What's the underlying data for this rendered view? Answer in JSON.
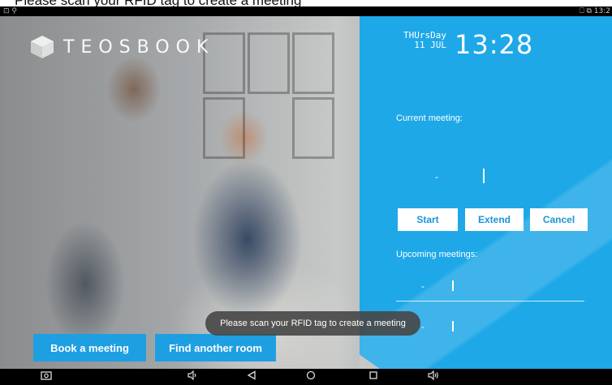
{
  "banner": {
    "text": "Please scan your RFID tag to create a meeting"
  },
  "statusbar": {
    "left_icons": "⊡ ⚲",
    "right_text": "⎕ ⧉  13:2"
  },
  "brand": {
    "name": "TEOSBOOK"
  },
  "clock": {
    "weekday": "THUrsDay",
    "date": "11 JUL",
    "time": "13:28"
  },
  "current_meeting": {
    "label": "Current meeting:",
    "dash": "-"
  },
  "actions": {
    "start": "Start",
    "extend": "Extend",
    "cancel": "Cancel"
  },
  "upcoming": {
    "label": "Upcoming meetings:",
    "items": [
      {
        "dash": "-"
      },
      {
        "dash": "-"
      }
    ]
  },
  "buttons": {
    "book": "Book a meeting",
    "find": "Find another room"
  },
  "toast": {
    "text": "Please scan your RFID tag to create a meeting"
  },
  "navbar": {
    "icons": [
      "camera-icon",
      "volume-down-icon",
      "back-icon",
      "home-icon",
      "recents-icon",
      "volume-up-icon"
    ]
  },
  "colors": {
    "accent": "#1ea8e8",
    "button_blue": "#1e9fe2"
  }
}
